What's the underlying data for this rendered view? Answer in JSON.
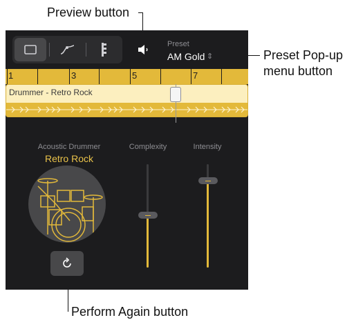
{
  "callouts": {
    "preview": "Preview button",
    "preset_line1": "Preset Pop-up",
    "preset_line2": "menu button",
    "perform": "Perform Again button"
  },
  "toolbar": {
    "tabs": [
      {
        "icon": "rectangle-icon",
        "selected": true
      },
      {
        "icon": "curve-icon",
        "selected": false
      },
      {
        "icon": "drummer-notation-icon",
        "selected": false
      }
    ],
    "preview_icon": "speaker-icon"
  },
  "preset": {
    "label": "Preset",
    "value": "AM Gold",
    "chevron": "chevron-updown-icon"
  },
  "ruler": {
    "numbers": [
      "1",
      "3",
      "5",
      "7"
    ]
  },
  "region": {
    "name": "Drummer - Retro Rock"
  },
  "drummer": {
    "type": "Acoustic Drummer",
    "name": "Retro Rock"
  },
  "sliders": {
    "complexity": {
      "label": "Complexity",
      "level": 0.45
    },
    "intensity": {
      "label": "Intensity",
      "level": 0.86
    }
  },
  "perform_again": {
    "icon": "refresh-icon"
  },
  "colors": {
    "accent": "#e3b93a",
    "panel": "#1c1c1e",
    "region": "#fcefbf"
  }
}
